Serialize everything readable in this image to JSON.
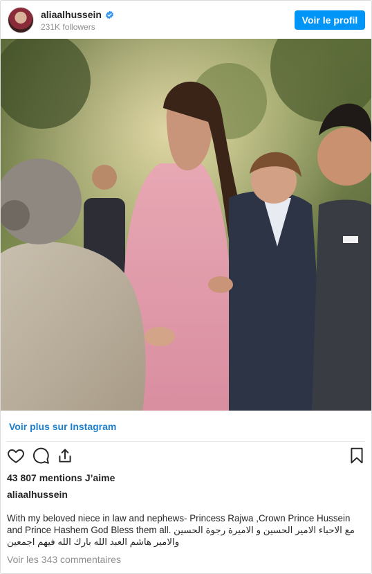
{
  "header": {
    "username": "aliaalhussein",
    "followers": "231K followers",
    "profile_button": "Voir le profil",
    "verified_icon": "verified-badge-icon"
  },
  "post": {
    "image_alt": "Photo of a group greeting outdoors",
    "view_more": "Voir plus sur Instagram",
    "likes": "43 807 mentions J’aime",
    "caption_user": "aliaalhussein",
    "caption_line1": "With my beloved niece in law and nephews- Princess Rajwa ,Crown Prince Hussein",
    "caption_line2": "and Prince Hashem God Bless them all. مع الاحباء الامير الحسين و الاميرة رجوة الحسين",
    "caption_line3": "والامير هاشم العبد الله بارك الله فيهم اجمعين",
    "comments": "Voir les 343 commentaires"
  },
  "icons": {
    "like": "heart-icon",
    "comment": "comment-icon",
    "share": "share-icon",
    "save": "bookmark-icon"
  },
  "colors": {
    "accent": "#0095f6",
    "link": "#1c7fd0",
    "muted": "#8e8e8e",
    "text": "#262626",
    "border": "#dbdbdb"
  }
}
